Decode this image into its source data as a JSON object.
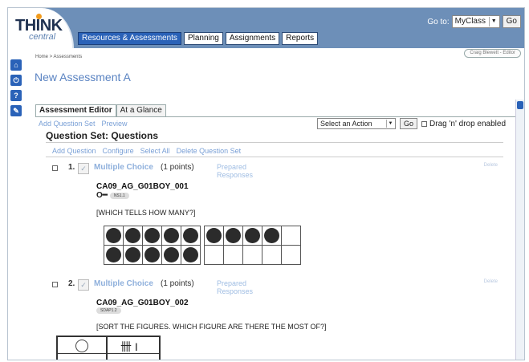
{
  "header": {
    "logo_think": "THINK",
    "logo_central": "central",
    "nav_tabs": [
      "Resources & Assessments",
      "Planning",
      "Assignments",
      "Reports"
    ],
    "goto_label": "Go to:",
    "goto_value": "MyClass",
    "goto_button": "Go"
  },
  "left_tools": [
    "home-icon",
    "power-icon",
    "help-icon",
    "wrench-icon"
  ],
  "breadcrumb": "Home > Assessments",
  "user_pill": "Craig Blewett - Editor",
  "page_title": "New Assessment A",
  "tabs": [
    "Assessment Editor",
    "At a Glance"
  ],
  "editor_links": [
    "Add Question Set",
    "Preview"
  ],
  "action": {
    "select_value": "Select an Action",
    "go": "Go",
    "dragdrop": "Drag 'n' drop enabled"
  },
  "question_set": {
    "title": "Question Set: Questions",
    "links": [
      "Add Question",
      "Configure",
      "Select All",
      "Delete Question Set"
    ]
  },
  "questions": [
    {
      "number": "1.",
      "type": "Multiple Choice",
      "points": "(1 points)",
      "prepared": "Prepared Responses",
      "delete": "Delete",
      "code": "CA09_AG_G01BOY_001",
      "tag": "NS1.1",
      "text": "[WHICH TELLS HOW MANY?]",
      "frames": [
        [
          1,
          1,
          1,
          1,
          1,
          1,
          1,
          1,
          1,
          1
        ],
        [
          1,
          1,
          1,
          1,
          0,
          0,
          0,
          0,
          0,
          0
        ]
      ]
    },
    {
      "number": "2.",
      "type": "Multiple Choice",
      "points": "(1 points)",
      "prepared": "Prepared Responses",
      "delete": "Delete",
      "code": "CA09_AG_G01BOY_002",
      "tag": "SDAP1.2",
      "text": "[SORT THE FIGURES. WHICH FIGURE ARE THERE THE MOST OF?]"
    }
  ],
  "colors": {
    "header_bg": "#6d8fb8",
    "active_tab": "#2a62b8",
    "link": "#7aa0d6",
    "title": "#5a83c2"
  }
}
